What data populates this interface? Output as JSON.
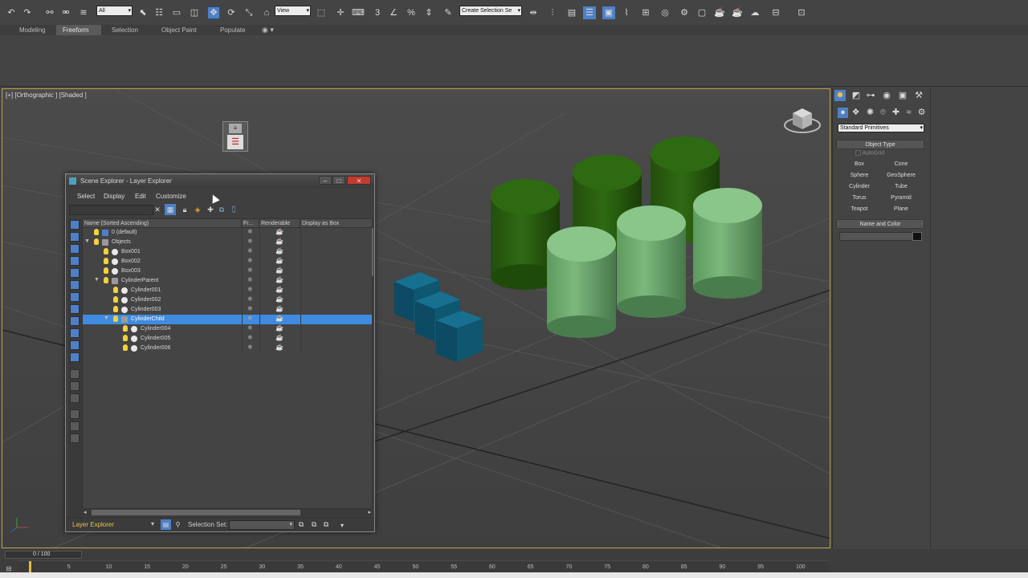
{
  "toolbar": {
    "selection_filter": "All",
    "ref_coord_system": "View",
    "named_selection_set": "Create Selection Se",
    "snap_numbers": "3"
  },
  "ribbon": {
    "tabs": [
      "Modeling",
      "Freeform",
      "Selection",
      "Object Paint",
      "Populate"
    ],
    "active_tab": "Freeform"
  },
  "viewport": {
    "label": "[+] [Orthographic ] [Shaded ]"
  },
  "scene_explorer": {
    "title": "Scene Explorer - Layer Explorer",
    "menu": [
      "Select",
      "Display",
      "Edit",
      "Customize"
    ],
    "columns": [
      "Name (Sorted Ascending)",
      "Fr...",
      "Renderable",
      "Display as Box"
    ],
    "rows": [
      {
        "name": "0 (default)",
        "level": 0,
        "type": "layer",
        "expand": "",
        "selected": false
      },
      {
        "name": "Objects",
        "level": 0,
        "type": "layer",
        "expand": "▼",
        "selected": false
      },
      {
        "name": "Box001",
        "level": 1,
        "type": "object",
        "expand": "",
        "selected": false
      },
      {
        "name": "Box002",
        "level": 1,
        "type": "object",
        "expand": "",
        "selected": false
      },
      {
        "name": "Box003",
        "level": 1,
        "type": "object",
        "expand": "",
        "selected": false
      },
      {
        "name": "CylinderParent",
        "level": 1,
        "type": "layer",
        "expand": "▼",
        "selected": false
      },
      {
        "name": "Cylinder001",
        "level": 2,
        "type": "object",
        "expand": "",
        "selected": false
      },
      {
        "name": "Cylinder002",
        "level": 2,
        "type": "object",
        "expand": "",
        "selected": false
      },
      {
        "name": "Cylinder003",
        "level": 2,
        "type": "object",
        "expand": "",
        "selected": false
      },
      {
        "name": "CylinderChild",
        "level": 2,
        "type": "layer",
        "expand": "▼",
        "selected": true
      },
      {
        "name": "Cylinder004",
        "level": 3,
        "type": "object",
        "expand": "",
        "selected": false
      },
      {
        "name": "Cylinder005",
        "level": 3,
        "type": "object",
        "expand": "",
        "selected": false
      },
      {
        "name": "Cylinder006",
        "level": 3,
        "type": "object",
        "expand": "",
        "selected": false
      }
    ],
    "status": {
      "mode_label": "Layer Explorer",
      "selection_set_label": "Selection Set:",
      "selection_set_value": ""
    }
  },
  "command_panel": {
    "category": "Standard Primitives",
    "object_type_title": "Object Type",
    "autogrid_label": "AutoGrid",
    "buttons": [
      "Box",
      "Cone",
      "Sphere",
      "GeoSphere",
      "Cylinder",
      "Tube",
      "Torus",
      "Pyramid",
      "Teapot",
      "Plane"
    ],
    "name_color_title": "Name and Color"
  },
  "timeline": {
    "frame_counter": "0 / 100",
    "ticks": [
      "5",
      "10",
      "15",
      "20",
      "25",
      "30",
      "35",
      "40",
      "45",
      "50",
      "55",
      "60",
      "65",
      "70",
      "75",
      "80",
      "85",
      "90",
      "95",
      "100"
    ]
  },
  "colors": {
    "viewport_border": "#b8a24a",
    "selection_blue": "#3e8be0",
    "cylinder_dark_green": "#2e6a12",
    "cylinder_light_green": "#76b276",
    "box_teal": "#0e5068"
  }
}
